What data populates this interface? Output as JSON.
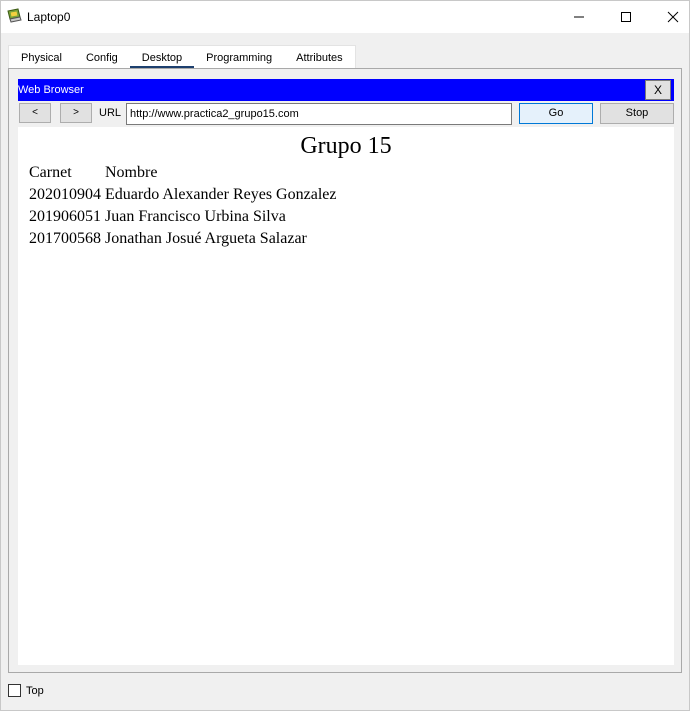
{
  "window": {
    "title": "Laptop0"
  },
  "tabs": [
    {
      "label": "Physical"
    },
    {
      "label": "Config"
    },
    {
      "label": "Desktop",
      "active": true
    },
    {
      "label": "Programming"
    },
    {
      "label": "Attributes"
    }
  ],
  "browser": {
    "title": "Web Browser",
    "close_label": "X",
    "back_label": "<",
    "forward_label": ">",
    "url_label": "URL",
    "url_value": "http://www.practica2_grupo15.com",
    "go_label": "Go",
    "stop_label": "Stop"
  },
  "page": {
    "heading": "Grupo 15",
    "columns": [
      "Carnet",
      "Nombre"
    ],
    "rows": [
      [
        "202010904",
        "Eduardo Alexander Reyes Gonzalez"
      ],
      [
        "201906051",
        "Juan Francisco Urbina Silva"
      ],
      [
        "201700568",
        "Jonathan Josué Argueta Salazar"
      ]
    ]
  },
  "footer": {
    "top_label": "Top"
  },
  "colors": {
    "browser_titlebar": "#0000ff",
    "active_tab_underline": "#1c3f6e"
  }
}
